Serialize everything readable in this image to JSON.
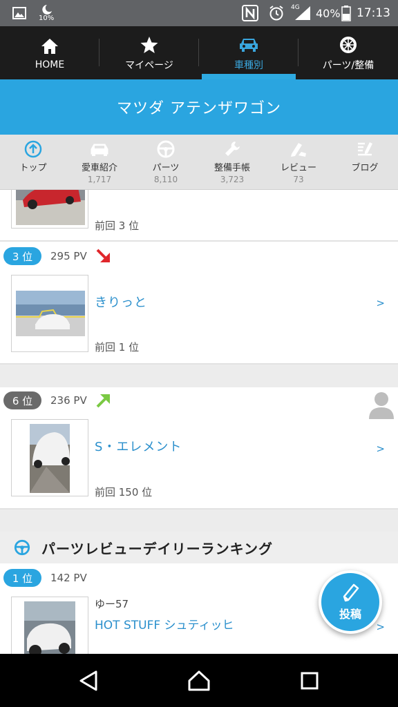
{
  "status_bar": {
    "battery_saver_pct": "10%",
    "network": "4G",
    "battery": "40%",
    "time": "17:13",
    "icons": [
      "image-icon",
      "moon-icon",
      "nfc-icon",
      "alarm-icon",
      "signal-icon",
      "battery-icon"
    ]
  },
  "top_nav": {
    "items": [
      {
        "label": "HOME",
        "icon": "home-icon"
      },
      {
        "label": "マイページ",
        "icon": "star-icon"
      },
      {
        "label": "車種別",
        "icon": "car-icon",
        "active": true
      },
      {
        "label": "パーツ/整備",
        "icon": "wheel-icon"
      }
    ]
  },
  "title": "マツダ アテンザワゴン",
  "sub_tabs": [
    {
      "label": "トップ",
      "count": "",
      "icon": "up-arrow-circle-icon"
    },
    {
      "label": "愛車紹介",
      "count": "1,717",
      "icon": "car-front-icon"
    },
    {
      "label": "パーツ",
      "count": "8,110",
      "icon": "steering-wheel-icon"
    },
    {
      "label": "整備手帳",
      "count": "3,723",
      "icon": "wrench-icon"
    },
    {
      "label": "レビュー",
      "count": "73",
      "icon": "review-icon"
    },
    {
      "label": "ブログ",
      "count": "",
      "icon": "blog-icon"
    }
  ],
  "entries": [
    {
      "prev": "前回 3 位"
    },
    {
      "rank": "3 位",
      "pv": "295 PV",
      "trend": "down",
      "title": "きりっと",
      "prev": "前回 1 位",
      "chevron": ">"
    },
    {
      "rank": "6 位",
      "pv": "236 PV",
      "trend": "up",
      "title": "S・エレメント",
      "prev": "前回 150 位",
      "chevron": ">"
    }
  ],
  "parts_section": {
    "heading": "パーツレビューデイリーランキング",
    "entry": {
      "rank": "1 位",
      "pv": "142 PV",
      "author": "ゆー57",
      "title": "HOT STUFF シュティッヒ",
      "chevron": ">"
    }
  },
  "fab": {
    "label": "投稿"
  },
  "colors": {
    "accent": "#2aa5e0",
    "nav_bg": "#1c1c1c",
    "status_bg": "#616366",
    "trend_down": "#e0262b",
    "trend_up": "#7ac943"
  }
}
